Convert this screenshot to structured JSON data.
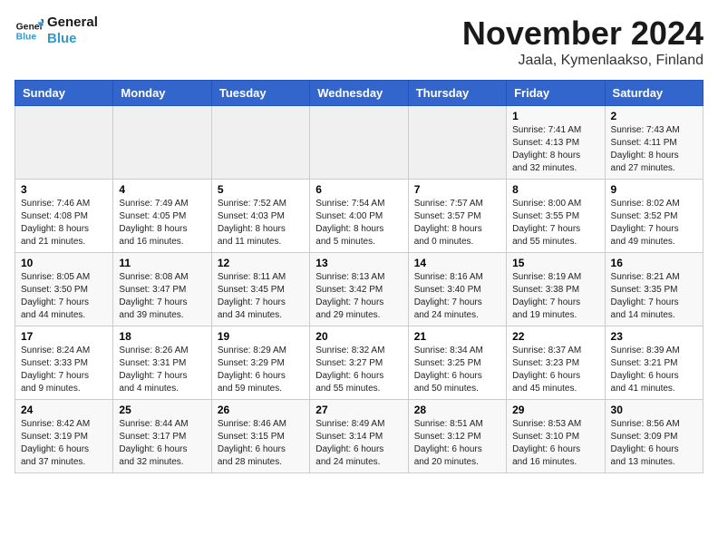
{
  "logo": {
    "line1": "General",
    "line2": "Blue"
  },
  "title": "November 2024",
  "location": "Jaala, Kymenlaakso, Finland",
  "days_of_week": [
    "Sunday",
    "Monday",
    "Tuesday",
    "Wednesday",
    "Thursday",
    "Friday",
    "Saturday"
  ],
  "weeks": [
    [
      {
        "day": "",
        "info": ""
      },
      {
        "day": "",
        "info": ""
      },
      {
        "day": "",
        "info": ""
      },
      {
        "day": "",
        "info": ""
      },
      {
        "day": "",
        "info": ""
      },
      {
        "day": "1",
        "info": "Sunrise: 7:41 AM\nSunset: 4:13 PM\nDaylight: 8 hours\nand 32 minutes."
      },
      {
        "day": "2",
        "info": "Sunrise: 7:43 AM\nSunset: 4:11 PM\nDaylight: 8 hours\nand 27 minutes."
      }
    ],
    [
      {
        "day": "3",
        "info": "Sunrise: 7:46 AM\nSunset: 4:08 PM\nDaylight: 8 hours\nand 21 minutes."
      },
      {
        "day": "4",
        "info": "Sunrise: 7:49 AM\nSunset: 4:05 PM\nDaylight: 8 hours\nand 16 minutes."
      },
      {
        "day": "5",
        "info": "Sunrise: 7:52 AM\nSunset: 4:03 PM\nDaylight: 8 hours\nand 11 minutes."
      },
      {
        "day": "6",
        "info": "Sunrise: 7:54 AM\nSunset: 4:00 PM\nDaylight: 8 hours\nand 5 minutes."
      },
      {
        "day": "7",
        "info": "Sunrise: 7:57 AM\nSunset: 3:57 PM\nDaylight: 8 hours\nand 0 minutes."
      },
      {
        "day": "8",
        "info": "Sunrise: 8:00 AM\nSunset: 3:55 PM\nDaylight: 7 hours\nand 55 minutes."
      },
      {
        "day": "9",
        "info": "Sunrise: 8:02 AM\nSunset: 3:52 PM\nDaylight: 7 hours\nand 49 minutes."
      }
    ],
    [
      {
        "day": "10",
        "info": "Sunrise: 8:05 AM\nSunset: 3:50 PM\nDaylight: 7 hours\nand 44 minutes."
      },
      {
        "day": "11",
        "info": "Sunrise: 8:08 AM\nSunset: 3:47 PM\nDaylight: 7 hours\nand 39 minutes."
      },
      {
        "day": "12",
        "info": "Sunrise: 8:11 AM\nSunset: 3:45 PM\nDaylight: 7 hours\nand 34 minutes."
      },
      {
        "day": "13",
        "info": "Sunrise: 8:13 AM\nSunset: 3:42 PM\nDaylight: 7 hours\nand 29 minutes."
      },
      {
        "day": "14",
        "info": "Sunrise: 8:16 AM\nSunset: 3:40 PM\nDaylight: 7 hours\nand 24 minutes."
      },
      {
        "day": "15",
        "info": "Sunrise: 8:19 AM\nSunset: 3:38 PM\nDaylight: 7 hours\nand 19 minutes."
      },
      {
        "day": "16",
        "info": "Sunrise: 8:21 AM\nSunset: 3:35 PM\nDaylight: 7 hours\nand 14 minutes."
      }
    ],
    [
      {
        "day": "17",
        "info": "Sunrise: 8:24 AM\nSunset: 3:33 PM\nDaylight: 7 hours\nand 9 minutes."
      },
      {
        "day": "18",
        "info": "Sunrise: 8:26 AM\nSunset: 3:31 PM\nDaylight: 7 hours\nand 4 minutes."
      },
      {
        "day": "19",
        "info": "Sunrise: 8:29 AM\nSunset: 3:29 PM\nDaylight: 6 hours\nand 59 minutes."
      },
      {
        "day": "20",
        "info": "Sunrise: 8:32 AM\nSunset: 3:27 PM\nDaylight: 6 hours\nand 55 minutes."
      },
      {
        "day": "21",
        "info": "Sunrise: 8:34 AM\nSunset: 3:25 PM\nDaylight: 6 hours\nand 50 minutes."
      },
      {
        "day": "22",
        "info": "Sunrise: 8:37 AM\nSunset: 3:23 PM\nDaylight: 6 hours\nand 45 minutes."
      },
      {
        "day": "23",
        "info": "Sunrise: 8:39 AM\nSunset: 3:21 PM\nDaylight: 6 hours\nand 41 minutes."
      }
    ],
    [
      {
        "day": "24",
        "info": "Sunrise: 8:42 AM\nSunset: 3:19 PM\nDaylight: 6 hours\nand 37 minutes."
      },
      {
        "day": "25",
        "info": "Sunrise: 8:44 AM\nSunset: 3:17 PM\nDaylight: 6 hours\nand 32 minutes."
      },
      {
        "day": "26",
        "info": "Sunrise: 8:46 AM\nSunset: 3:15 PM\nDaylight: 6 hours\nand 28 minutes."
      },
      {
        "day": "27",
        "info": "Sunrise: 8:49 AM\nSunset: 3:14 PM\nDaylight: 6 hours\nand 24 minutes."
      },
      {
        "day": "28",
        "info": "Sunrise: 8:51 AM\nSunset: 3:12 PM\nDaylight: 6 hours\nand 20 minutes."
      },
      {
        "day": "29",
        "info": "Sunrise: 8:53 AM\nSunset: 3:10 PM\nDaylight: 6 hours\nand 16 minutes."
      },
      {
        "day": "30",
        "info": "Sunrise: 8:56 AM\nSunset: 3:09 PM\nDaylight: 6 hours\nand 13 minutes."
      }
    ]
  ]
}
